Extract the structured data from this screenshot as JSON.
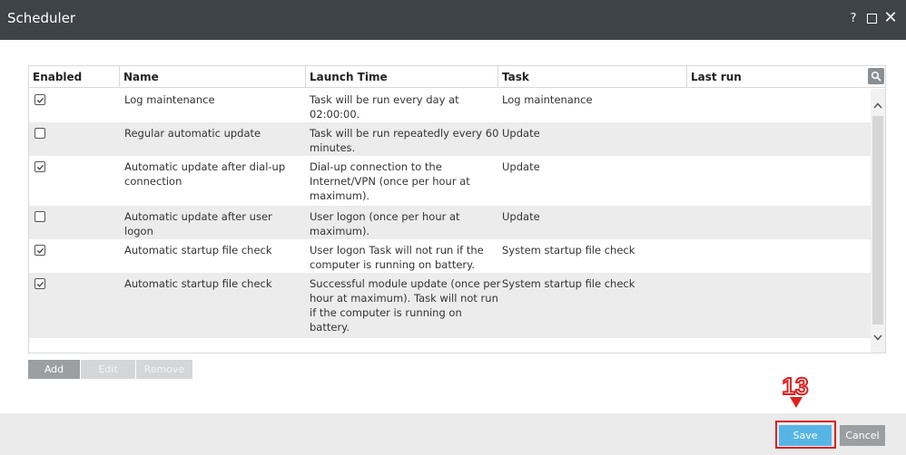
{
  "window": {
    "title": "Scheduler",
    "help_label": "?",
    "colors": {
      "titlebar": "#3d4348",
      "accent": "#57b5e6",
      "highlight": "#e02020"
    }
  },
  "table": {
    "headers": [
      "Enabled",
      "Name",
      "Launch Time",
      "Task",
      "Last run"
    ],
    "rows": [
      {
        "enabled": true,
        "name": "Log maintenance",
        "launch_time": "Task will be run every day at 02:00:00.",
        "task": "Log maintenance",
        "last_run": ""
      },
      {
        "enabled": false,
        "name": "Regular automatic update",
        "launch_time": "Task will be run repeatedly every 60 minutes.",
        "task": "Update",
        "last_run": ""
      },
      {
        "enabled": true,
        "name": "Automatic update after dial-up connection",
        "launch_time": "Dial-up connection to the Internet/VPN (once per hour at maximum).",
        "task": "Update",
        "last_run": ""
      },
      {
        "enabled": false,
        "name": "Automatic update after user logon",
        "launch_time": "User logon (once per hour at maximum).",
        "task": "Update",
        "last_run": ""
      },
      {
        "enabled": true,
        "name": "Automatic startup file check",
        "launch_time": "User logon Task will not run if the computer is running on battery.",
        "task": "System startup file check",
        "last_run": ""
      },
      {
        "enabled": true,
        "name": "Automatic startup file check",
        "launch_time": "Successful module update (once per hour at maximum). Task will not run if the computer is running on battery.",
        "task": "System startup file check",
        "last_run": ""
      }
    ]
  },
  "actions": {
    "add": "Add",
    "edit": "Edit",
    "remove": "Remove"
  },
  "annotation": {
    "step": "13"
  },
  "footer": {
    "save": "Save",
    "cancel": "Cancel"
  }
}
